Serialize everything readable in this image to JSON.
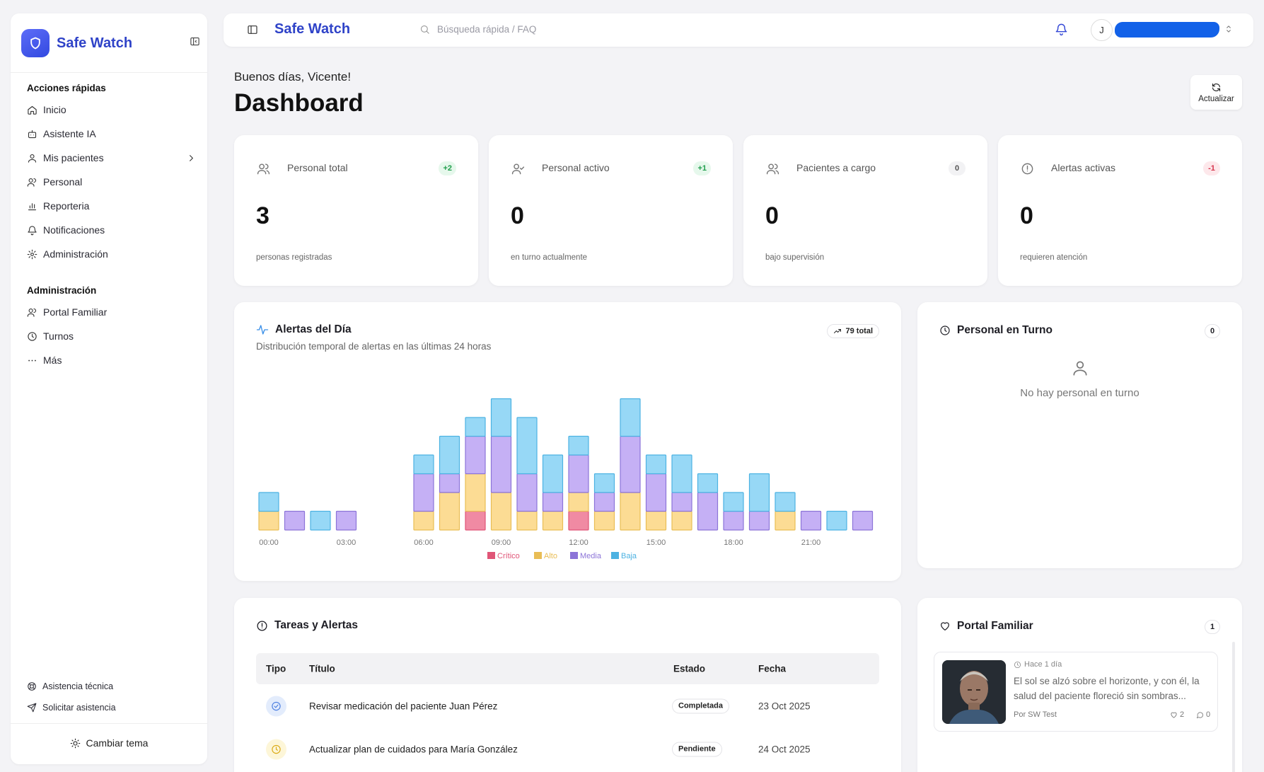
{
  "brand": {
    "name": "Safe Watch"
  },
  "sidebar": {
    "sections": [
      {
        "title": "Acciones rápidas"
      },
      {
        "title": "Administración"
      }
    ],
    "quick_items": [
      {
        "label": "Inicio",
        "icon": "home-icon"
      },
      {
        "label": "Asistente IA",
        "icon": "bot-icon"
      },
      {
        "label": "Mis pacientes",
        "icon": "user-icon"
      },
      {
        "label": "Personal",
        "icon": "users-icon"
      },
      {
        "label": "Reporteria",
        "icon": "bar-chart-icon"
      },
      {
        "label": "Notificaciones",
        "icon": "bell-icon"
      },
      {
        "label": "Administración",
        "icon": "gear-icon"
      }
    ],
    "admin_items": [
      {
        "label": "Portal Familiar",
        "icon": "users-icon"
      },
      {
        "label": "Turnos",
        "icon": "clock-icon"
      },
      {
        "label": "Más",
        "icon": "ellipsis-icon"
      }
    ],
    "footer": {
      "support": "Asistencia técnica",
      "request": "Solicitar asistencia",
      "theme": "Cambiar tema"
    }
  },
  "topbar": {
    "title": "Safe Watch",
    "search_placeholder": "Búsqueda rápida / FAQ",
    "avatar_initial": "J"
  },
  "header": {
    "greeting": "Buenos días, Vicente!",
    "title": "Dashboard",
    "refresh_label": "Actualizar"
  },
  "stats": [
    {
      "label": "Personal total",
      "badge": "+2",
      "value": "3",
      "sub": "personas registradas",
      "icon": "users-icon"
    },
    {
      "label": "Personal activo",
      "badge": "+1",
      "value": "0",
      "sub": "en turno actualmente",
      "icon": "user-check-icon"
    },
    {
      "label": "Pacientes a cargo",
      "badge": "0",
      "value": "0",
      "sub": "bajo supervisión",
      "icon": "users-icon"
    },
    {
      "label": "Alertas activas",
      "badge": "-1",
      "value": "0",
      "sub": "requieren atención",
      "icon": "alert-circle-icon"
    }
  ],
  "alerts_card": {
    "title": "Alertas del Día",
    "subtitle": "Distribución temporal de alertas en las últimas 24 horas",
    "total": "79 total"
  },
  "chart_data": {
    "type": "bar",
    "stacked": true,
    "categories": [
      "00:00",
      "01:00",
      "02:00",
      "03:00",
      "04:00",
      "05:00",
      "06:00",
      "07:00",
      "08:00",
      "09:00",
      "10:00",
      "11:00",
      "12:00",
      "13:00",
      "14:00",
      "15:00",
      "16:00",
      "17:00",
      "18:00",
      "19:00",
      "20:00",
      "21:00",
      "22:00",
      "23:00"
    ],
    "tick_labels": [
      "00:00",
      "03:00",
      "06:00",
      "09:00",
      "12:00",
      "15:00",
      "18:00",
      "21:00"
    ],
    "series": [
      {
        "name": "Crítico",
        "color": "#f08aa3",
        "values": [
          0,
          0,
          0,
          0,
          0,
          0,
          0,
          0,
          1,
          0,
          0,
          0,
          1,
          0,
          0,
          0,
          0,
          0,
          0,
          0,
          0,
          0,
          0,
          0
        ]
      },
      {
        "name": "Alto",
        "color": "#fcdc94",
        "values": [
          1,
          0,
          0,
          0,
          0,
          0,
          1,
          2,
          2,
          2,
          1,
          1,
          1,
          1,
          2,
          1,
          1,
          0,
          0,
          0,
          1,
          0,
          0,
          0
        ]
      },
      {
        "name": "Media",
        "color": "#c5b0f5",
        "values": [
          0,
          1,
          0,
          1,
          0,
          0,
          2,
          1,
          2,
          3,
          2,
          1,
          2,
          1,
          3,
          2,
          1,
          2,
          1,
          1,
          0,
          1,
          0,
          1
        ]
      },
      {
        "name": "Baja",
        "color": "#97d8f6",
        "values": [
          1,
          0,
          1,
          0,
          0,
          0,
          1,
          2,
          1,
          2,
          3,
          2,
          1,
          1,
          2,
          1,
          2,
          1,
          1,
          2,
          1,
          0,
          1,
          0
        ]
      }
    ],
    "ylim": [
      0,
      8
    ],
    "legend_position": "bottom"
  },
  "turno_card": {
    "title": "Personal en Turno",
    "count": "0",
    "empty": "No hay personal en turno"
  },
  "tasks_card": {
    "title": "Tareas y Alertas",
    "columns": [
      "Tipo",
      "Título",
      "Estado",
      "Fecha"
    ],
    "rows": [
      {
        "type_icon": "check-circle-icon",
        "title": "Revisar medicación del paciente Juan Pérez",
        "status": "Completada",
        "date": "23 Oct 2025"
      },
      {
        "type_icon": "clock-icon",
        "title": "Actualizar plan de cuidados para María González",
        "status": "Pendiente",
        "date": "24 Oct 2025"
      }
    ]
  },
  "portal_card": {
    "title": "Portal Familiar",
    "count": "1",
    "post": {
      "time": "Hace 1 día",
      "text": "El sol se alzó sobre el horizonte, y con él, la salud del paciente floreció sin sombras...",
      "author": "Por SW Test",
      "likes": "2",
      "comments": "0"
    }
  }
}
